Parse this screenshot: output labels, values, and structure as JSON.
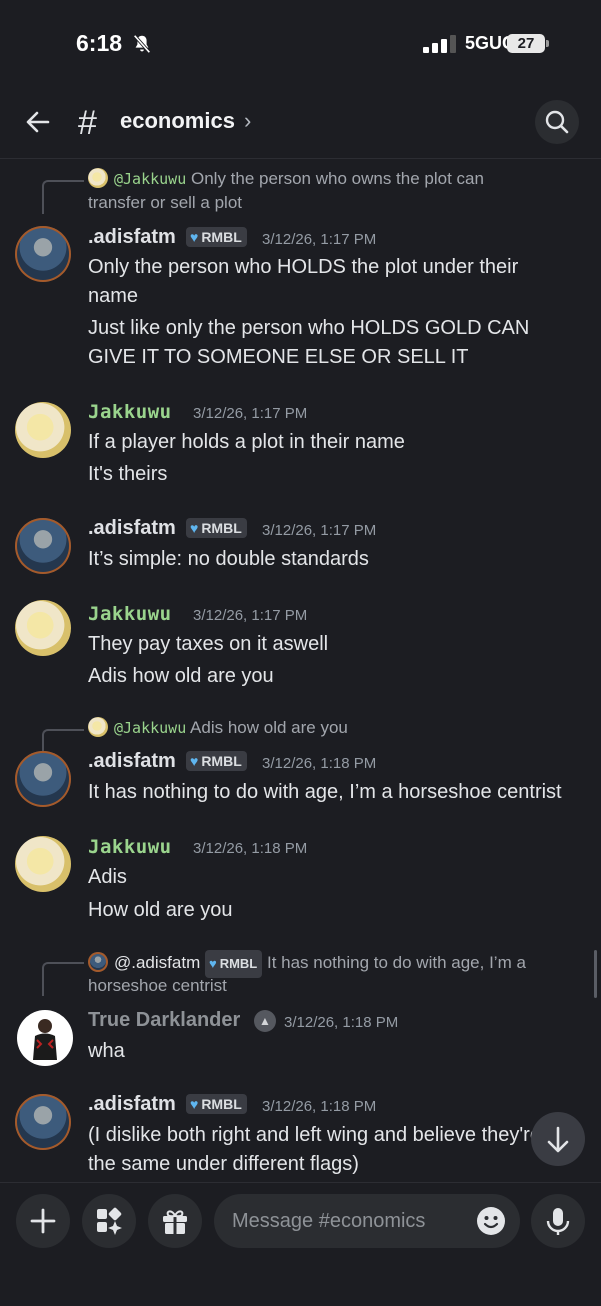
{
  "status_bar": {
    "time": "6:18",
    "network": "5GUC",
    "battery": "27"
  },
  "header": {
    "channel": "economics",
    "chevron": "›"
  },
  "messages": [
    {
      "reply": {
        "mention": "@Jakkuwu",
        "text_line1": "Only the person who owns the plot can",
        "text_line2": "transfer or sell a plot"
      },
      "author": ".adisfatm",
      "badge": "RMBL",
      "timestamp": "3/12/26, 1:17 PM",
      "lines": [
        "Only the person who HOLDS the plot under their",
        "name",
        "Just like only the person who HOLDS GOLD CAN",
        "GIVE IT TO SOMEONE ELSE OR SELL IT"
      ]
    },
    {
      "author": "Jakkuwu",
      "timestamp": "3/12/26, 1:17 PM",
      "lines": [
        "If a player holds a plot in their name",
        "It's theirs"
      ]
    },
    {
      "author": ".adisfatm",
      "badge": "RMBL",
      "timestamp": "3/12/26, 1:17 PM",
      "lines": [
        "It’s simple: no double standards"
      ]
    },
    {
      "author": "Jakkuwu",
      "timestamp": "3/12/26, 1:17 PM",
      "lines": [
        "They pay taxes on it aswell",
        "Adis how old are you"
      ]
    },
    {
      "reply": {
        "mention": "@Jakkuwu",
        "text_line1": "Adis how old are you"
      },
      "author": ".adisfatm",
      "badge": "RMBL",
      "timestamp": "3/12/26, 1:18 PM",
      "lines": [
        "It has nothing to do with age, I’m a horseshoe centrist"
      ]
    },
    {
      "author": "Jakkuwu",
      "timestamp": "3/12/26, 1:18 PM",
      "lines": [
        "Adis",
        "How old are you"
      ]
    },
    {
      "reply": {
        "mention": "@.adisfatm",
        "badge": "RMBL",
        "text_line1": "It has nothing to do with age, I’m a",
        "text_line2": "horseshoe centrist"
      },
      "author": "True Darklander",
      "timestamp": "3/12/26, 1:18 PM",
      "lines": [
        "wha"
      ]
    },
    {
      "author": ".adisfatm",
      "badge": "RMBL",
      "timestamp": "3/12/26, 1:18 PM",
      "lines": [
        "(I dislike both right and left wing and believe they're",
        "the same under different flags)"
      ]
    }
  ],
  "composer": {
    "placeholder": "Message #economics"
  },
  "colors": {
    "background": "#1c1d22",
    "jakkuwu_name": "#9ad48d",
    "badge_heart": "#5fb6f0"
  }
}
